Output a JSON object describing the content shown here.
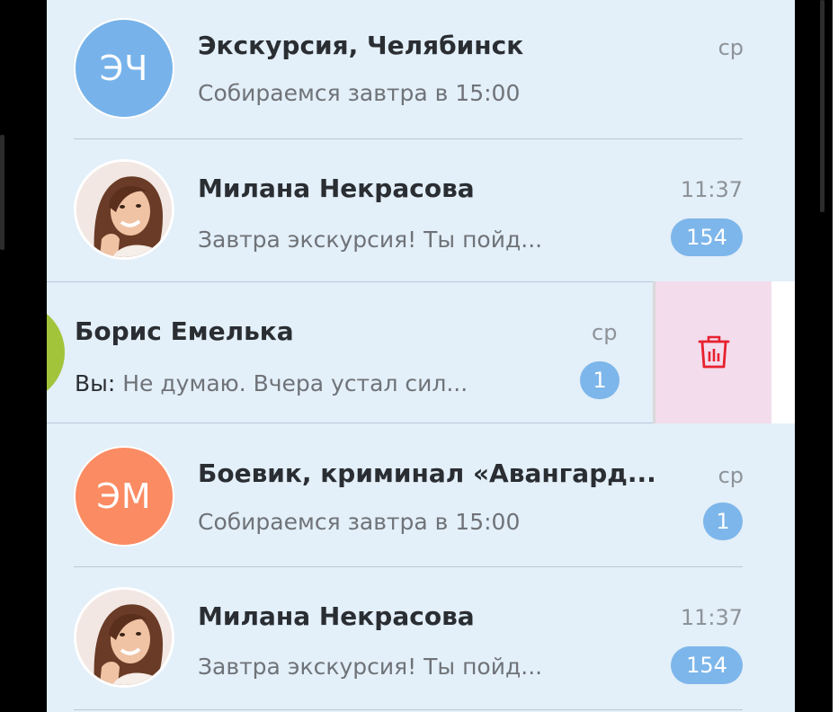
{
  "chats": [
    {
      "id": "chat-1",
      "initials": "ЭЧ",
      "name": "Экскурсия, Челябинск",
      "preview": "Собираемся завтра в 15:00",
      "time": "ср",
      "badge": null
    },
    {
      "id": "chat-2",
      "name": "Милана Некрасова",
      "preview": "Завтра экскурсия! Ты пойд...",
      "time": "11:37",
      "badge": "154"
    },
    {
      "id": "chat-3",
      "name": "Борис  Емелька",
      "sender": "Вы:",
      "preview": " Не думаю. Вчера устал сил...",
      "time": "ср",
      "badge": "1"
    },
    {
      "id": "chat-4",
      "initials": "ЭМ",
      "name": "Боевик, криминал «Авангард...",
      "preview": "Собираемся завтра в 15:00",
      "time": "ср",
      "badge": "1"
    },
    {
      "id": "chat-5",
      "name": "Милана Некрасова",
      "preview": "Завтра экскурсия! Ты пойд...",
      "time": "11:37",
      "badge": "154"
    }
  ],
  "actions": {
    "delete_icon": "trash-icon"
  },
  "colors": {
    "background": "#e3eff9",
    "avatar_blue": "#77b3ea",
    "avatar_orange": "#fb8b62",
    "badge": "#7db6ea",
    "delete_bg": "#f3dcec",
    "delete_icon": "#e8202e"
  }
}
